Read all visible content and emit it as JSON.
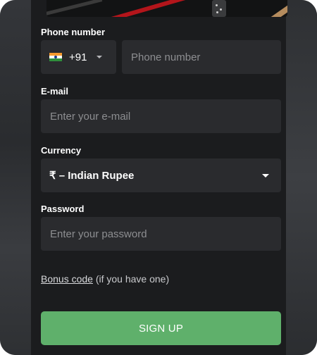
{
  "form": {
    "phone_label": "Phone number",
    "country_code": "+91",
    "phone_placeholder": "Phone number",
    "email_label": "E-mail",
    "email_placeholder": "Enter your e-mail",
    "currency_label": "Currency",
    "currency_value": "₹ – Indian Rupee",
    "password_label": "Password",
    "password_placeholder": "Enter your password",
    "bonus_link": "Bonus code",
    "bonus_hint": " (if you have one)",
    "signup_label": "SIGN UP"
  },
  "icons": {
    "country_flag": "india-flag-icon",
    "dropdown": "chevron-down-icon"
  },
  "colors": {
    "background": "#1b1c1e",
    "field": "#2a2b2e",
    "accent": "#5fb06b",
    "text": "#ffffff",
    "placeholder": "#8d8e91"
  }
}
